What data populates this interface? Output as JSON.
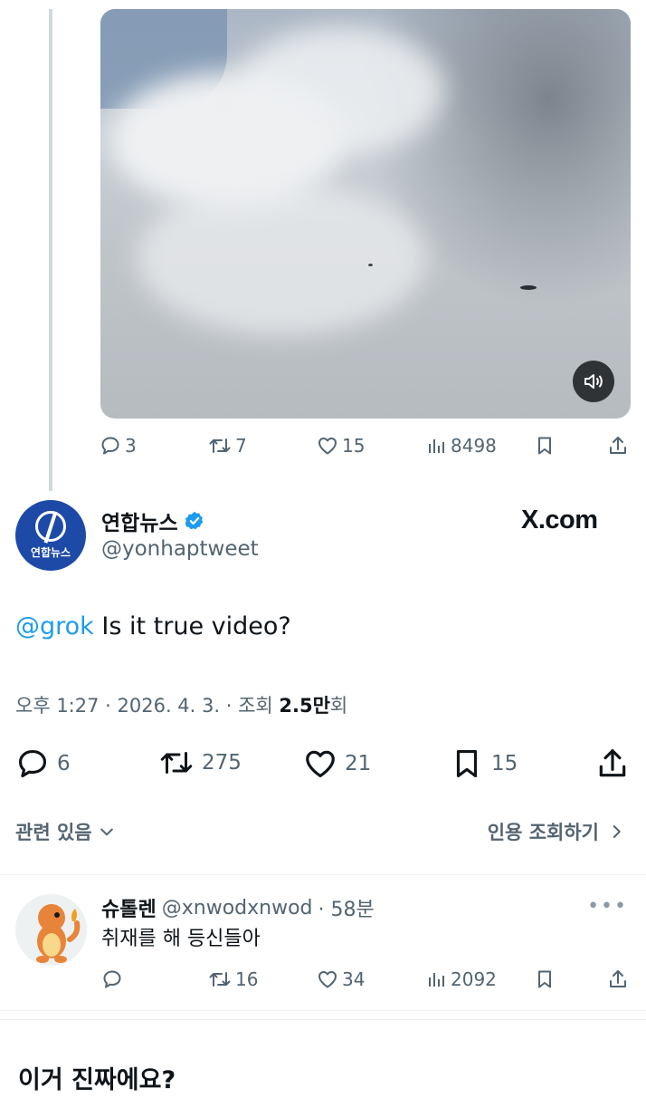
{
  "quoted_post": {
    "video": {
      "sound_icon": "speaker-icon"
    },
    "actions": {
      "replies": "3",
      "reposts": "7",
      "likes": "15",
      "views": "8498"
    }
  },
  "post": {
    "author_name": "연합뉴스",
    "author_handle": "@yonhaptweet",
    "avatar_text": "연합뉴스",
    "watermark": "X.com",
    "mention": "@grok",
    "text": " Is it true video?",
    "meta_prefix": "오후 1:27 · 2026. 4. 3. · 조회 ",
    "meta_views": "2.5만",
    "meta_suffix": "회",
    "actions": {
      "replies": "6",
      "reposts": "275",
      "likes": "21",
      "bookmarks": "15"
    },
    "related_label": "관련 있음",
    "quotes_label": "인용 조회하기"
  },
  "reply": {
    "name": "슈톨렌",
    "handle": "@xnwodxnwod",
    "time": "· 58분",
    "text": "취재를 해 등신들아",
    "actions": {
      "replies": "",
      "reposts": "16",
      "likes": "34",
      "views": "2092"
    }
  },
  "caption": "이거 진짜에요?",
  "colors": {
    "accent": "#1d9bf0",
    "secondary_text": "#536471",
    "verified": "#1d9bf0",
    "yonhap_blue": "#1d4aa7"
  }
}
